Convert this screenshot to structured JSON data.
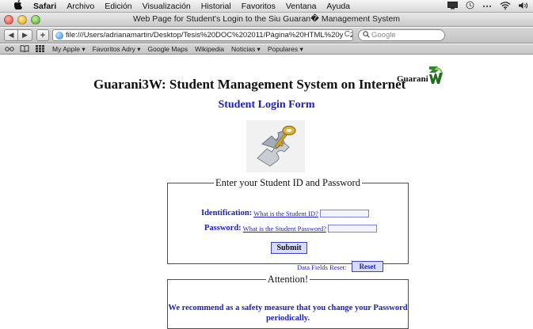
{
  "menubar": {
    "items": [
      "Safari",
      "Archivo",
      "Edición",
      "Visualización",
      "Historial",
      "Favoritos",
      "Ventana",
      "Ayuda"
    ]
  },
  "window": {
    "title": "Web Page for Student's Login to the Siu Guaran� Management System"
  },
  "toolbar": {
    "back": "◀",
    "forward": "▶",
    "add": "+",
    "url": "file:///Users/adrianamartin/Desktop/Tesis%20DOC%202011/Página%20HTML%20y%20CSS/Te",
    "reload": "C",
    "search_placeholder": "Google"
  },
  "bookmarks": {
    "items": [
      "My Apple ▾",
      "Favoritos Adry ▾",
      "Google Maps",
      "Wikipedia",
      "Noticias ▾",
      "Populares ▾"
    ]
  },
  "page": {
    "title": "Guarani3W: Student Management System on Internet",
    "logo_text": "Guarani",
    "logo_mark": "3W",
    "subtitle": "Student Login Form",
    "login_legend": "Enter your Student ID and Password",
    "id_label": "Identification:",
    "id_help": "What is the Student ID?",
    "pw_label": "Password:",
    "pw_help": "What is the Student Password?",
    "submit": "Submit",
    "reset_label": "Data Fields Reset:",
    "reset": "Reset",
    "attention_legend": "Attention!",
    "attention_text": "We recommend as a safety measure that you change your Password periodically."
  }
}
